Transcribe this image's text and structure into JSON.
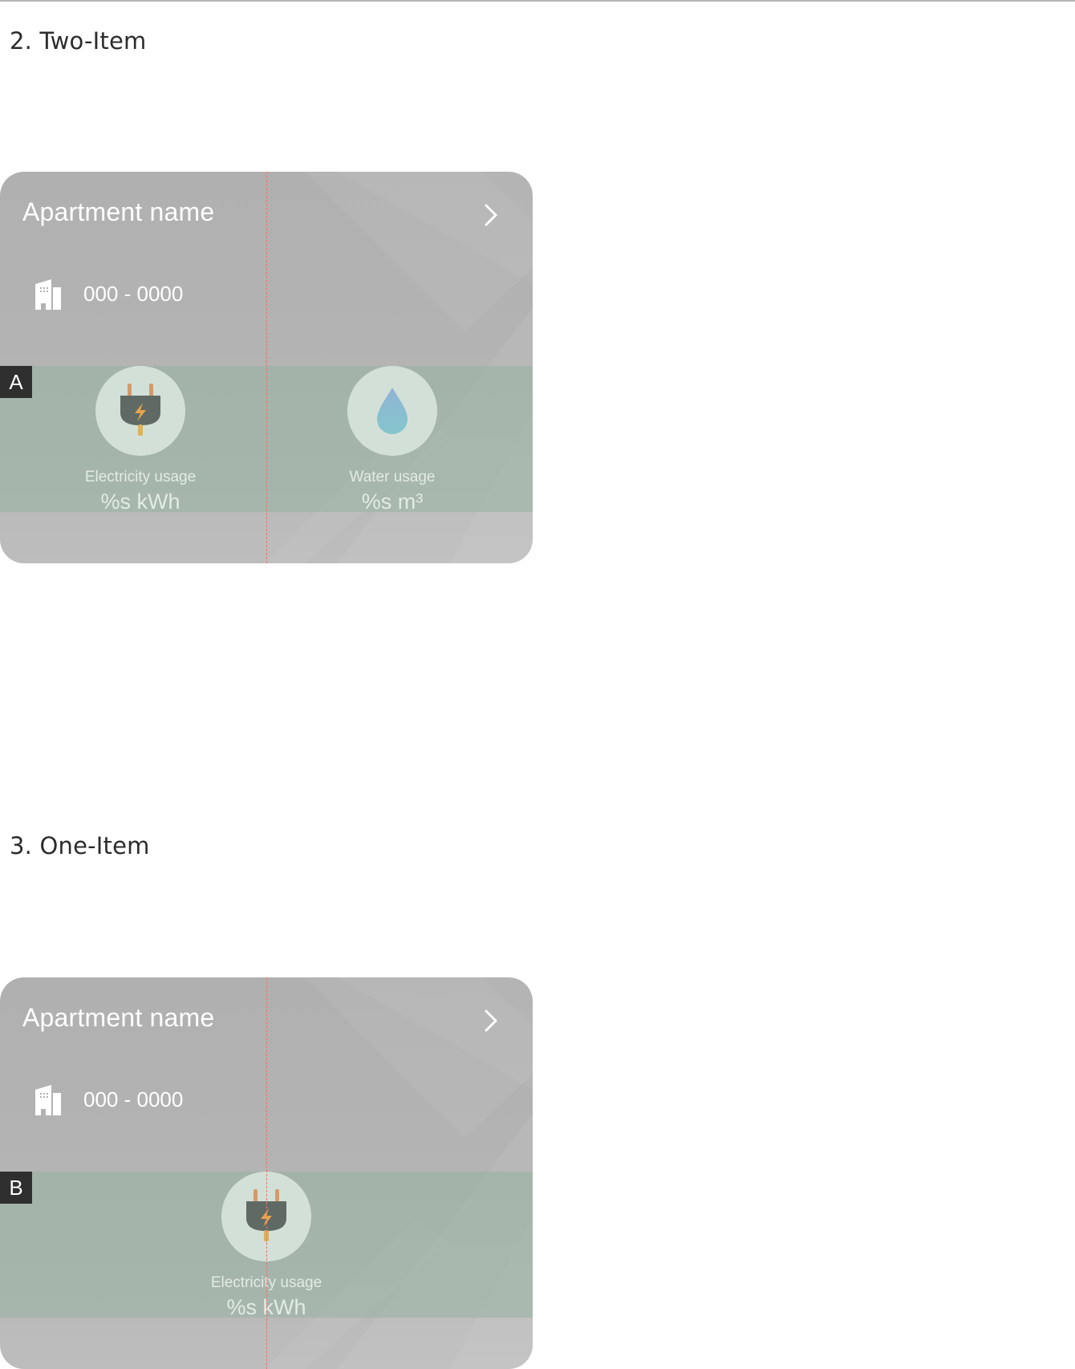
{
  "sections": [
    {
      "title": "2. Two-Item",
      "marker": "A",
      "card": {
        "apartment_name": "Apartment name",
        "apartment_number": "000 - 0000",
        "items": [
          {
            "icon": "plug-icon",
            "label": "Electricity usage",
            "value": "%s kWh"
          },
          {
            "icon": "water-drop-icon",
            "label": "Water usage",
            "value": "%s m³"
          }
        ]
      }
    },
    {
      "title": "3. One-Item",
      "marker": "B",
      "card": {
        "apartment_name": "Apartment name",
        "apartment_number": "000 - 0000",
        "items": [
          {
            "icon": "plug-icon",
            "label": "Electricity usage",
            "value": "%s kWh"
          }
        ]
      }
    }
  ],
  "colors": {
    "card_background": "#b4b4b4",
    "usage_band": "#a3b5a9",
    "icon_circle": "#d3e0d8",
    "guide_line": "#e07a6a",
    "marker_background": "#2f2f2f"
  }
}
